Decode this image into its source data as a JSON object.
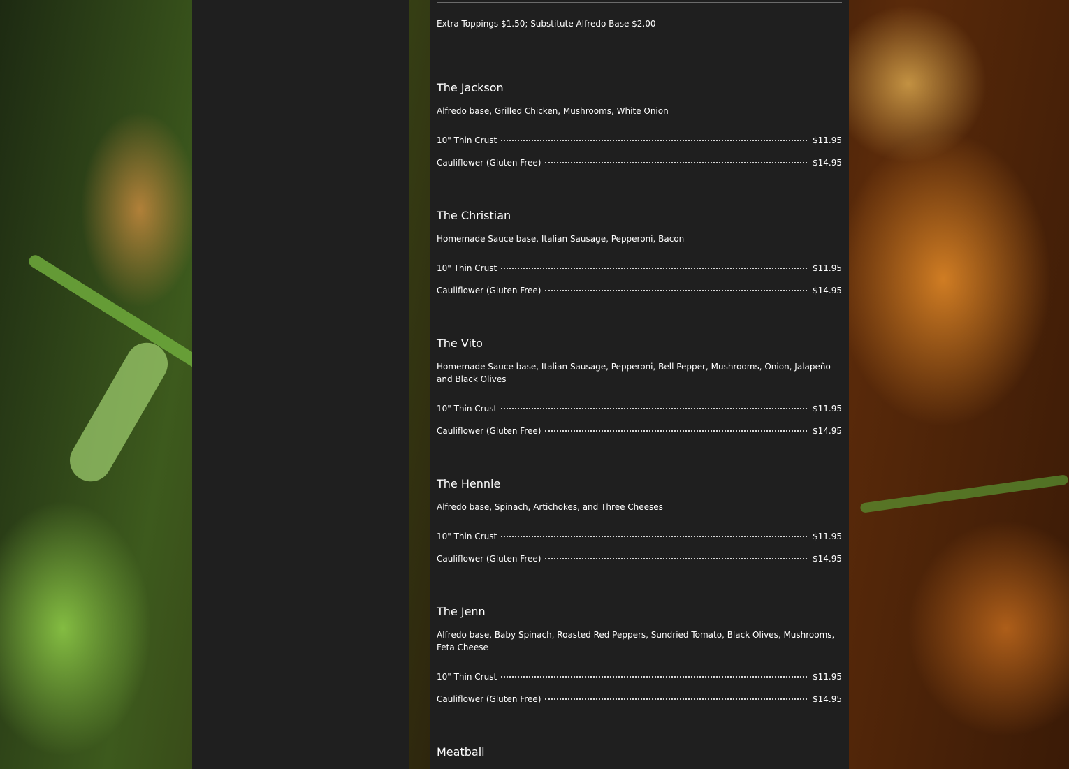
{
  "note": "Extra Toppings $1.50; Substitute Alfredo Base $2.00",
  "items": [
    {
      "title": "The Jackson",
      "description": "Alfredo base, Grilled Chicken, Mushrooms, White Onion",
      "prices": [
        {
          "variant": "10\" Thin Crust",
          "price": "$11.95"
        },
        {
          "variant": "Cauliflower (Gluten Free)",
          "price": "$14.95"
        }
      ]
    },
    {
      "title": "The Christian",
      "description": "Homemade Sauce base, Italian Sausage, Pepperoni, Bacon",
      "prices": [
        {
          "variant": "10\" Thin Crust",
          "price": "$11.95"
        },
        {
          "variant": "Cauliflower (Gluten Free)",
          "price": "$14.95"
        }
      ]
    },
    {
      "title": "The Vito",
      "description": "Homemade Sauce base, Italian Sausage, Pepperoni, Bell Pepper, Mushrooms, Onion, Jalapeño and Black Olives",
      "prices": [
        {
          "variant": "10\" Thin Crust",
          "price": "$11.95"
        },
        {
          "variant": "Cauliflower (Gluten Free)",
          "price": "$14.95"
        }
      ]
    },
    {
      "title": "The Hennie",
      "description": "Alfredo base, Spinach, Artichokes, and Three Cheeses",
      "prices": [
        {
          "variant": "10\" Thin Crust",
          "price": "$11.95"
        },
        {
          "variant": "Cauliflower (Gluten Free)",
          "price": "$14.95"
        }
      ]
    },
    {
      "title": "The Jenn",
      "description": "Alfredo base, Baby Spinach, Roasted Red Peppers, Sundried Tomato, Black Olives, Mushrooms, Feta Cheese",
      "prices": [
        {
          "variant": "10\" Thin Crust",
          "price": "$11.95"
        },
        {
          "variant": "Cauliflower (Gluten Free)",
          "price": "$14.95"
        }
      ]
    },
    {
      "title": "Meatball",
      "description": "",
      "prices": []
    }
  ]
}
